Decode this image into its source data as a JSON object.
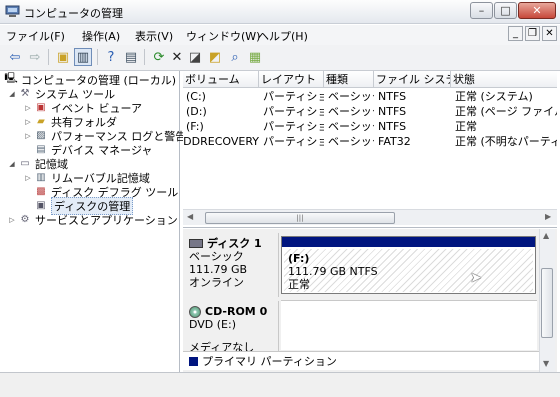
{
  "window": {
    "title": "コンピュータの管理",
    "min_glyph": "–",
    "max_glyph": "□",
    "close_glyph": "✕"
  },
  "menu": [
    "ファイル(F)",
    "操作(A)",
    "表示(V)",
    "ウィンドウ(W)",
    "ヘルプ(H)"
  ],
  "mdi_buttons": [
    "_",
    "❐",
    "✕"
  ],
  "tree": {
    "root": "コンピュータの管理 (ローカル)",
    "system_tools": "システム ツール",
    "event_viewer": "イベント ビューア",
    "shared_folders": "共有フォルダ",
    "performance": "パフォーマンス ログと警告",
    "device_manager": "デバイス マネージャ",
    "storage": "記憶域",
    "removable": "リムーバブル記憶域",
    "defrag": "ディスク デフラグ ツール",
    "disk_mgmt": "ディスクの管理",
    "services": "サービスとアプリケーション"
  },
  "volumes": {
    "columns": [
      "ボリューム",
      "レイアウト",
      "種類",
      "ファイル システム",
      "状態"
    ],
    "rows": [
      {
        "volume": "(C:)",
        "layout": "パーティション",
        "type": "ベーシック",
        "fs": "NTFS",
        "status": "正常 (システム)"
      },
      {
        "volume": "(D:)",
        "layout": "パーティション",
        "type": "ベーシック",
        "fs": "NTFS",
        "status": "正常 (ページ ファイル)"
      },
      {
        "volume": "(F:)",
        "layout": "パーティション",
        "type": "ベーシック",
        "fs": "NTFS",
        "status": "正常"
      },
      {
        "volume": "HDDRECOVERY",
        "layout": "パーティション",
        "type": "ベーシック",
        "fs": "FAT32",
        "status": "正常 (不明なパーティション)"
      }
    ]
  },
  "disk1": {
    "name": "ディスク 1",
    "type": "ベーシック",
    "size": "111.79 GB",
    "status": "オンライン",
    "partition": {
      "label": "(F:)",
      "size_fs": "111.79 GB NTFS",
      "status": "正常"
    }
  },
  "cdrom": {
    "name": "CD-ROM 0",
    "drive": "DVD (E:)",
    "media": "メディアなし"
  },
  "legend": {
    "label": "プライマリ パーティション",
    "color": "#00157f"
  }
}
